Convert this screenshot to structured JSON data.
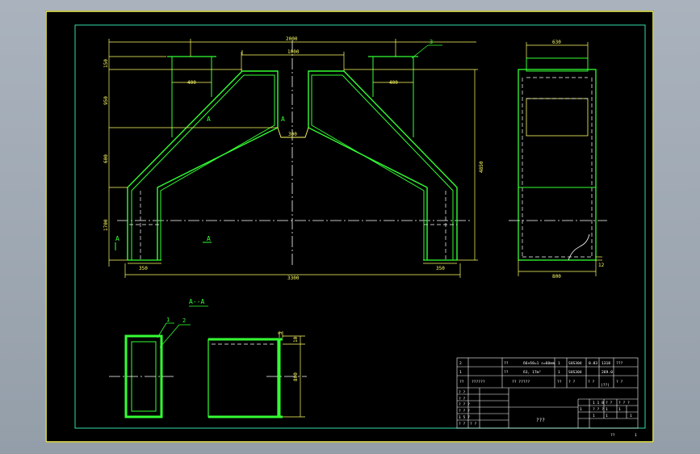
{
  "colors": {
    "background": "#000000",
    "outer_frame": "#ffff66",
    "inner_frame": "#33ddaa",
    "part_outline": "#33ff33",
    "dimension": "#ffff66",
    "centerline": "#ffffff",
    "hidden_line": "#ffffff",
    "text": "#ffffff"
  },
  "front_view": {
    "dims": {
      "overall_top": "2000",
      "top_inner": "1000",
      "left_flange": "400",
      "right_flange": "400",
      "throat": "300",
      "bottom_left": "350",
      "bottom_right": "350",
      "overall_bottom": "3300",
      "height_total": "4850",
      "h1": "150",
      "h2": "950",
      "h3": "600",
      "h4": "1700"
    },
    "section_marks": [
      "A",
      "A",
      "A",
      "A"
    ],
    "balloon": "3"
  },
  "side_view": {
    "dims": {
      "top": "630",
      "bottom": "800",
      "corner": "12"
    }
  },
  "section_view": {
    "title": "A--A",
    "balloons": [
      "1",
      "2"
    ],
    "dims": {
      "height": "800",
      "thick": "10",
      "gap": "5"
    }
  },
  "title_block": {
    "rows": [
      {
        "no": "2",
        "name": "??",
        "spec": "δ6×δ8=1 s=60mm",
        "qty": "1",
        "material": "SUS304",
        "w1": "0.83",
        "w2": "1318",
        "note": "???"
      },
      {
        "no": "1",
        "name": "??",
        "spec": "δ3, 17m²",
        "qty": "1",
        "material": "SUS304",
        "w1": "",
        "w2": "269.0",
        "note": ""
      }
    ],
    "header": {
      "c1": "??",
      "c2": "??????",
      "c3": "?? ?????",
      "c4": "??",
      "c5": "? ?",
      "c6": "? ?",
      "c7": "(??)",
      "c8": "? ?"
    },
    "left_labels": [
      "? ?",
      "? ?",
      "? ? ?",
      "? ? ?",
      "1 5 7",
      "? ?",
      "? ?"
    ],
    "drawing_name": "???",
    "right_labels": [
      "1 1 8",
      "? ?",
      "? ? ?",
      "1",
      "? ? ?",
      "1",
      "1",
      "1",
      "1",
      "1"
    ],
    "sheet_info": {
      "label": "??",
      "value": "1"
    }
  }
}
